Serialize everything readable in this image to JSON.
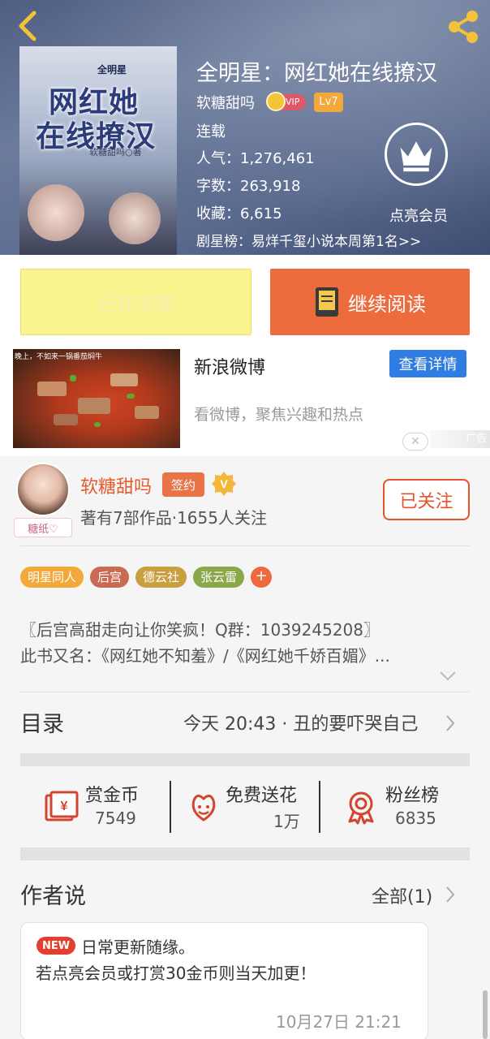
{
  "header": {
    "back_icon": "chevron-left-icon",
    "share_icon": "share-icon",
    "cover": {
      "small_title": "全明星",
      "title_line1": "网红她",
      "title_line2": "在线撩汉",
      "author_text": "软糖甜吗○著"
    },
    "book_title": "全明星：网红她在线撩汉",
    "author": "软糖甜吗",
    "vip_badge": "VIP",
    "level_badge": "Lv7",
    "status": "连载",
    "popularity": "人气：1,276,461",
    "word_count": "字数：263,918",
    "favorites": "收藏：6,615",
    "rank": "剧星榜：易烊千玺小说本周第1名>>",
    "vip_member_label": "点亮会员"
  },
  "actions": {
    "shelf_label": "已在书架",
    "read_label": "继续阅读"
  },
  "ad": {
    "image_caption": "晚上，不如来一锅番茄焖牛",
    "name": "新浪微博",
    "detail_label": "查看详情",
    "description": "看微博，聚焦兴趣和热点",
    "close_symbol": "✕",
    "tag": "广告"
  },
  "author_card": {
    "avatar_tag": "糖纸♡",
    "name": "软糖甜吗",
    "sign_badge": "签约",
    "v_badge": "V",
    "stats": "著有7部作品·1655人关注",
    "follow_label": "已关注"
  },
  "tags": [
    {
      "label": "明星同人",
      "color": "#f3a83a"
    },
    {
      "label": "后宫",
      "color": "#c96a53"
    },
    {
      "label": "德云社",
      "color": "#c8a040"
    },
    {
      "label": "张云雷",
      "color": "#8aa84a"
    }
  ],
  "tag_add_symbol": "+",
  "description": {
    "line1": "〖后宫高甜走向让你笑疯！Q群：1039245208〗",
    "line2": "此书又名：《网红她不知羞》/《网红她千娇百媚》..."
  },
  "toc": {
    "label": "目录",
    "latest": "今天 20:43 · 丑的要吓哭自己"
  },
  "stats": [
    {
      "label": "赏金币",
      "value": "7549",
      "icon": "reward-coin-icon"
    },
    {
      "label": "免费送花",
      "value": "1万",
      "icon": "flower-icon"
    },
    {
      "label": "粉丝榜",
      "value": "6835",
      "icon": "medal-icon"
    }
  ],
  "author_says": {
    "label": "作者说",
    "all_label": "全部(1)",
    "note": {
      "badge": "NEW",
      "line1": "日常更新随缘。",
      "line2": "若点亮会员或打赏30金币则当天加更！",
      "time": "10月27日  21:21"
    }
  },
  "colors": {
    "accent_orange": "#ec6c3e",
    "shelf_yellow": "#fbf38d",
    "link_blue": "#2f7ce3",
    "author_name": "#e65a2b"
  }
}
